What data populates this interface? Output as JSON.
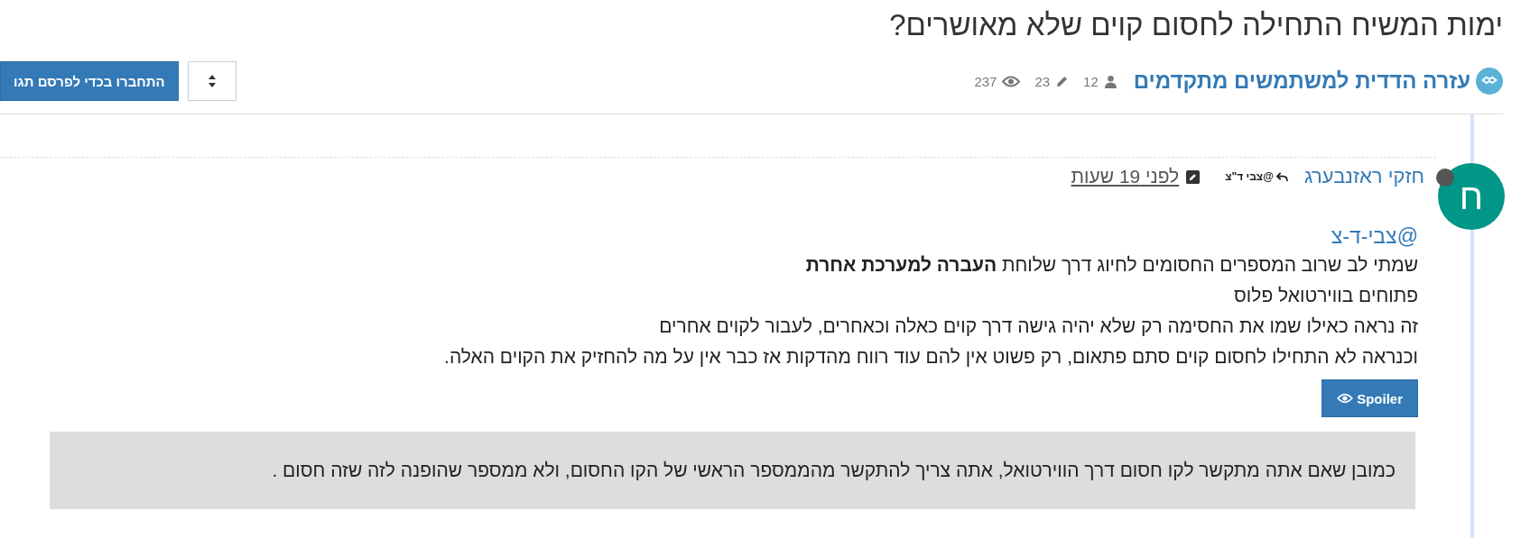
{
  "topic": {
    "title": "ימות המשיח התחילה לחסום קוים שלא מאושרים?",
    "category": {
      "name": "עזרה הדדית למשתמשים מתקדמים",
      "color": "#59b1d6"
    },
    "stats": [
      {
        "kind": "posters",
        "value": "12"
      },
      {
        "kind": "posts",
        "value": "23"
      },
      {
        "kind": "views",
        "value": "237"
      }
    ],
    "login_button": "התחברו בכדי לפרסם תגו"
  },
  "post": {
    "avatar_letter": "ח",
    "online": false,
    "author": "חזקי ראזנבערג",
    "reply_to": "@צבי ד\"צ",
    "edited": true,
    "time": "לפני 19 שעות",
    "mention": "@צבי-ד-צ",
    "lines": [
      "שמתי לב שרוב המספרים החסומים לחיוג דרך שלוחת **העברה למערכת אחרת**",
      "פתוחים בווירטואל פלוס",
      "זה נראה כאילו שמו את החסימה רק שלא יהיה גישה דרך קוים כאלה וכאחרים, לעבור לקוים אחרים",
      "וכנראה לא התחילו לחסום קוים סתם פתאום, רק פשוט אין להם עוד רווח מהדקות אז כבר אין על מה להחזיק את הקוים האלה."
    ],
    "spoiler": {
      "label": "Spoiler",
      "expanded": true,
      "text": "כמובן שאם אתה מתקשר לקו חסום דרך הווירטואל, אתה צריך להתקשר מהממספר הראשי של הקו החסום, ולא ממספר שהופנה לזה שזה חסום ."
    }
  }
}
